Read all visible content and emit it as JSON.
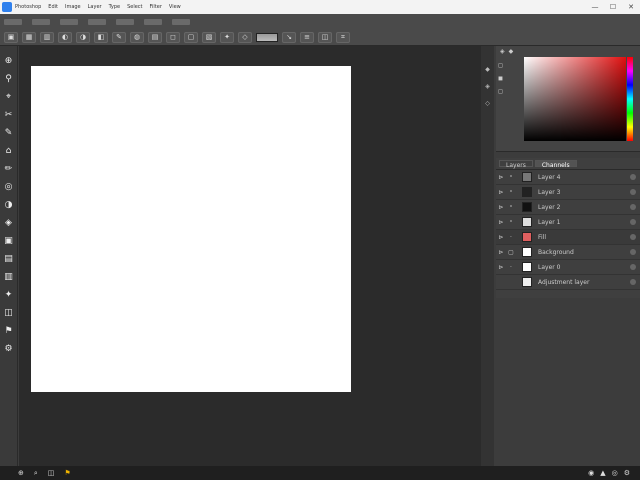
{
  "titlebar": {
    "menu": [
      "Photoshop",
      "Edit",
      "Image",
      "Layer",
      "Type",
      "Select",
      "Filter",
      "View"
    ],
    "controls": {
      "minimize": "—",
      "maximize": "☐",
      "close": "✕"
    }
  },
  "options": {
    "row1": [
      "",
      "",
      "",
      "",
      "",
      "",
      ""
    ],
    "buttons": [
      "▣",
      "▦",
      "▥",
      "◐",
      "◑",
      "◧",
      "✎",
      "◍",
      "▤",
      "◻",
      "▢",
      "▧",
      "✦",
      "◇",
      "↘",
      "≡",
      "◫",
      "⌗"
    ]
  },
  "toolbar": {
    "tools": [
      {
        "glyph": "⊕",
        "name": "move"
      },
      {
        "glyph": "⚲",
        "name": "lasso"
      },
      {
        "glyph": "⌖",
        "name": "quick-select"
      },
      {
        "glyph": "✂",
        "name": "crop"
      },
      {
        "glyph": "✎",
        "name": "eyedropper"
      },
      {
        "glyph": "⌂",
        "name": "healing"
      },
      {
        "glyph": "✏",
        "name": "brush"
      },
      {
        "glyph": "◎",
        "name": "stamp"
      },
      {
        "glyph": "◑",
        "name": "history-brush"
      },
      {
        "glyph": "◈",
        "name": "eraser"
      },
      {
        "glyph": "▣",
        "name": "gradient"
      },
      {
        "glyph": "▤",
        "name": "dodge"
      },
      {
        "glyph": "▥",
        "name": "pen"
      },
      {
        "glyph": "✦",
        "name": "type"
      },
      {
        "glyph": "◫",
        "name": "shape"
      },
      {
        "glyph": "⚑",
        "name": "hand"
      },
      {
        "glyph": "⚙",
        "name": "zoom"
      }
    ]
  },
  "colorpanel": {
    "header": [
      "◈",
      "◆"
    ],
    "swatch_labels": [
      "◻",
      "◼",
      "◻"
    ]
  },
  "layers": {
    "tabs": [
      {
        "label": "Layers"
      },
      {
        "label": "Channels"
      }
    ],
    "rows": [
      {
        "eye": "⊳",
        "ex": "ˣ",
        "thumb": "#777",
        "name": "Layer 4"
      },
      {
        "eye": "⊳",
        "ex": "ˣ",
        "thumb": "#222",
        "name": "Layer 3"
      },
      {
        "eye": "⊳",
        "ex": "ˣ",
        "thumb": "#111",
        "name": "Layer 2"
      },
      {
        "eye": "⊳",
        "ex": "ˣ",
        "thumb": "#ddd",
        "name": "Layer 1"
      },
      {
        "eye": "⊳",
        "ex": "·",
        "thumb": "#e06060",
        "name": "Fill"
      },
      {
        "eye": "⊳",
        "ex": "▢",
        "thumb": "#fff",
        "name": "Background"
      },
      {
        "eye": "⊳",
        "ex": "·",
        "thumb": "#fff",
        "name": "Layer 0"
      },
      {
        "eye": "",
        "ex": "",
        "thumb": "#eee",
        "name": "Adjustment layer"
      }
    ]
  },
  "status": {
    "docinfo": "",
    "icons": [
      "⊕",
      "⌕",
      "◫",
      "⚑"
    ],
    "tray": [
      "◉",
      "▲",
      "◎",
      "⚙"
    ]
  }
}
